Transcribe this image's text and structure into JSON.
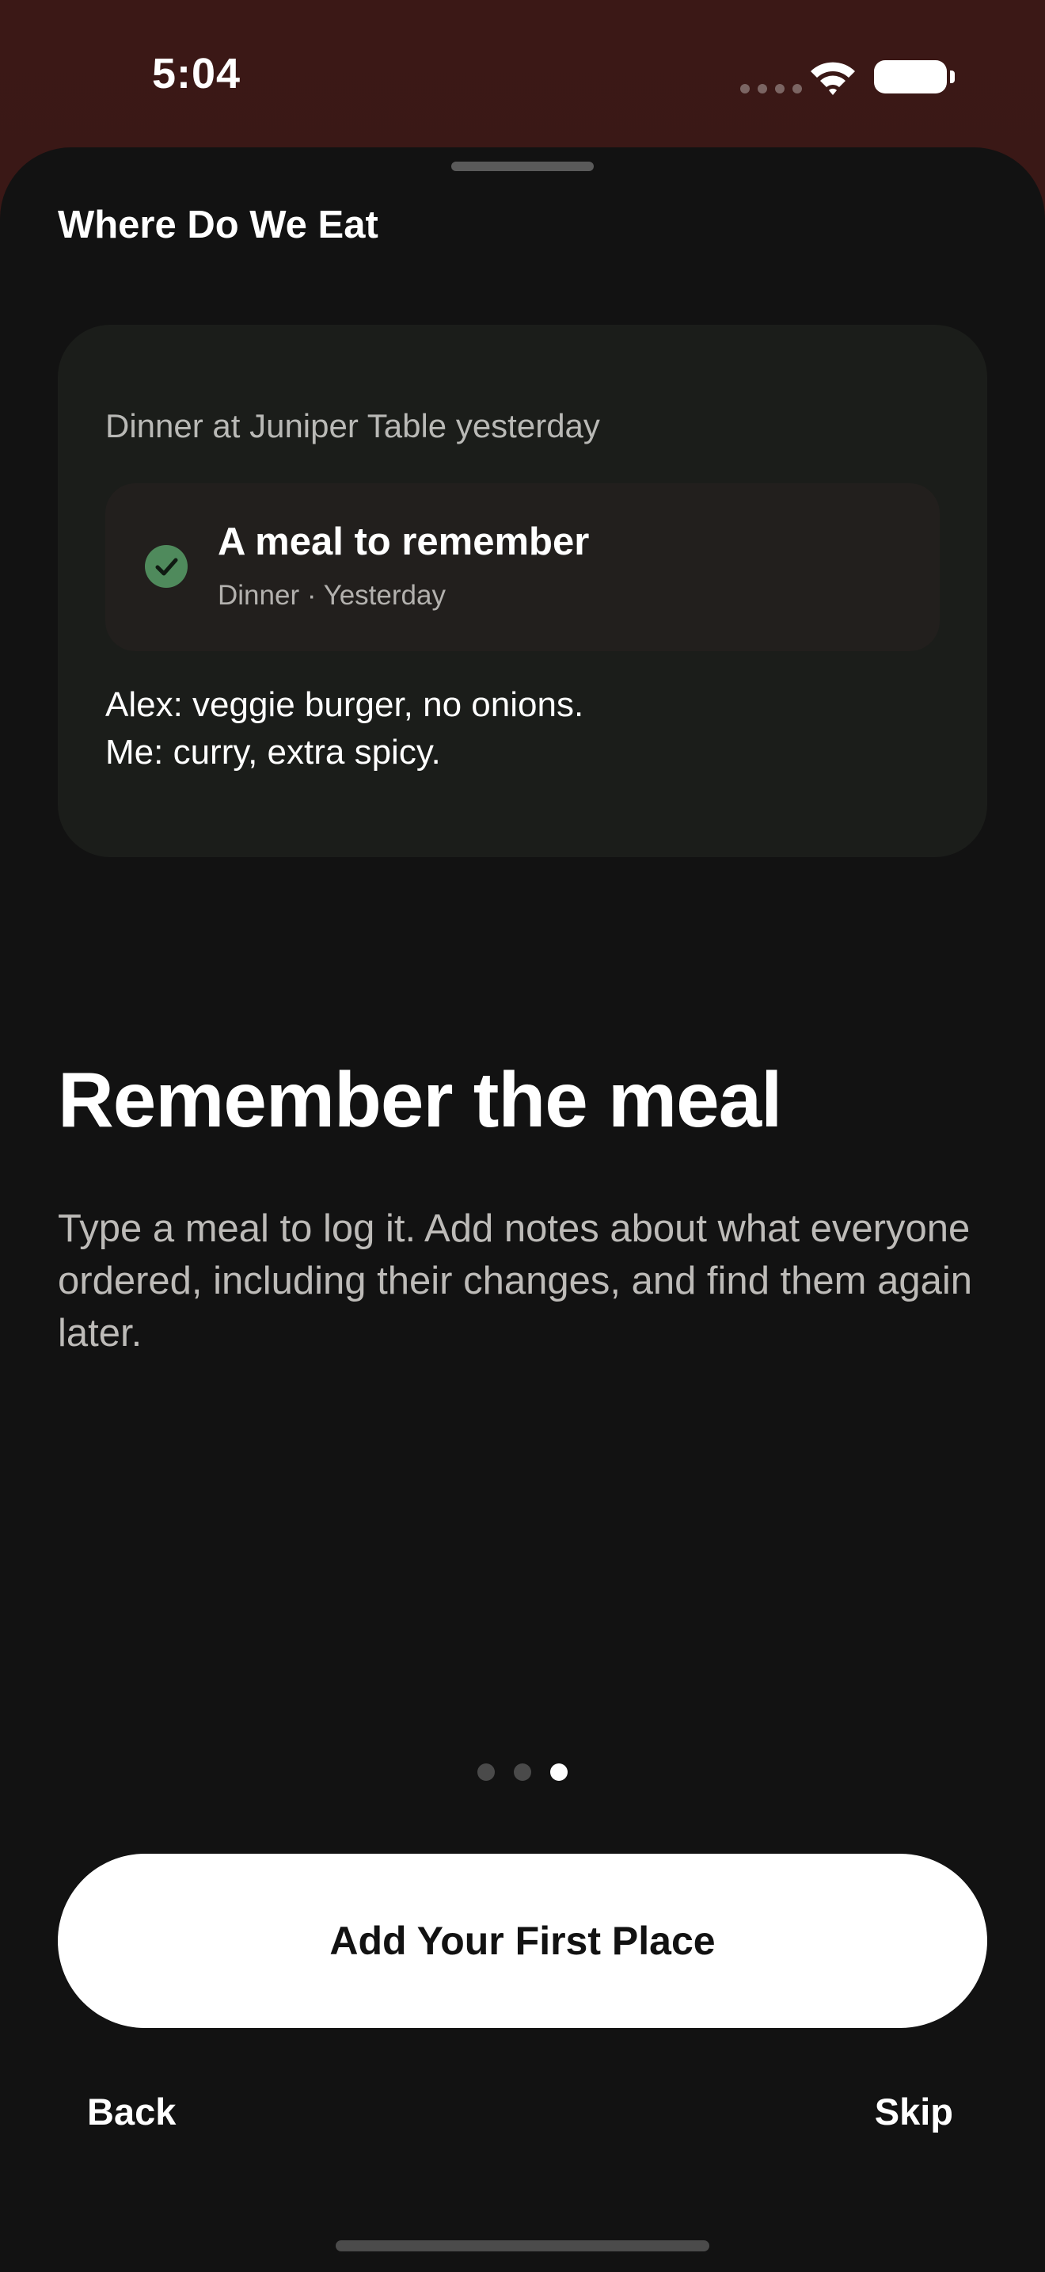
{
  "status_bar": {
    "time": "5:04"
  },
  "header": {
    "app_title": "Where Do We Eat"
  },
  "preview_card": {
    "caption": "Dinner at Juniper Table yesterday",
    "meal": {
      "title": "A meal to remember",
      "subtitle": "Dinner · Yesterday",
      "icon": "checkmark-circle-icon",
      "icon_color": "#4f8a5c"
    },
    "notes": [
      "Alex: veggie burger, no onions.",
      "Me: curry, extra spicy."
    ]
  },
  "onboarding": {
    "headline": "Remember the meal",
    "description": "Type a meal to log it. Add notes about what everyone ordered, including their changes, and find them again later.",
    "page_indicator": {
      "total_pages": 3,
      "current_page": 3
    }
  },
  "actions": {
    "primary_label": "Add Your First Place",
    "back_label": "Back",
    "skip_label": "Skip"
  },
  "colors": {
    "background_top": "#3b1816",
    "sheet": "#121212",
    "card": "#1b1d1a",
    "meal_row": "#221f1d",
    "accent_green": "#4f8a5c",
    "button": "#ffffff"
  }
}
